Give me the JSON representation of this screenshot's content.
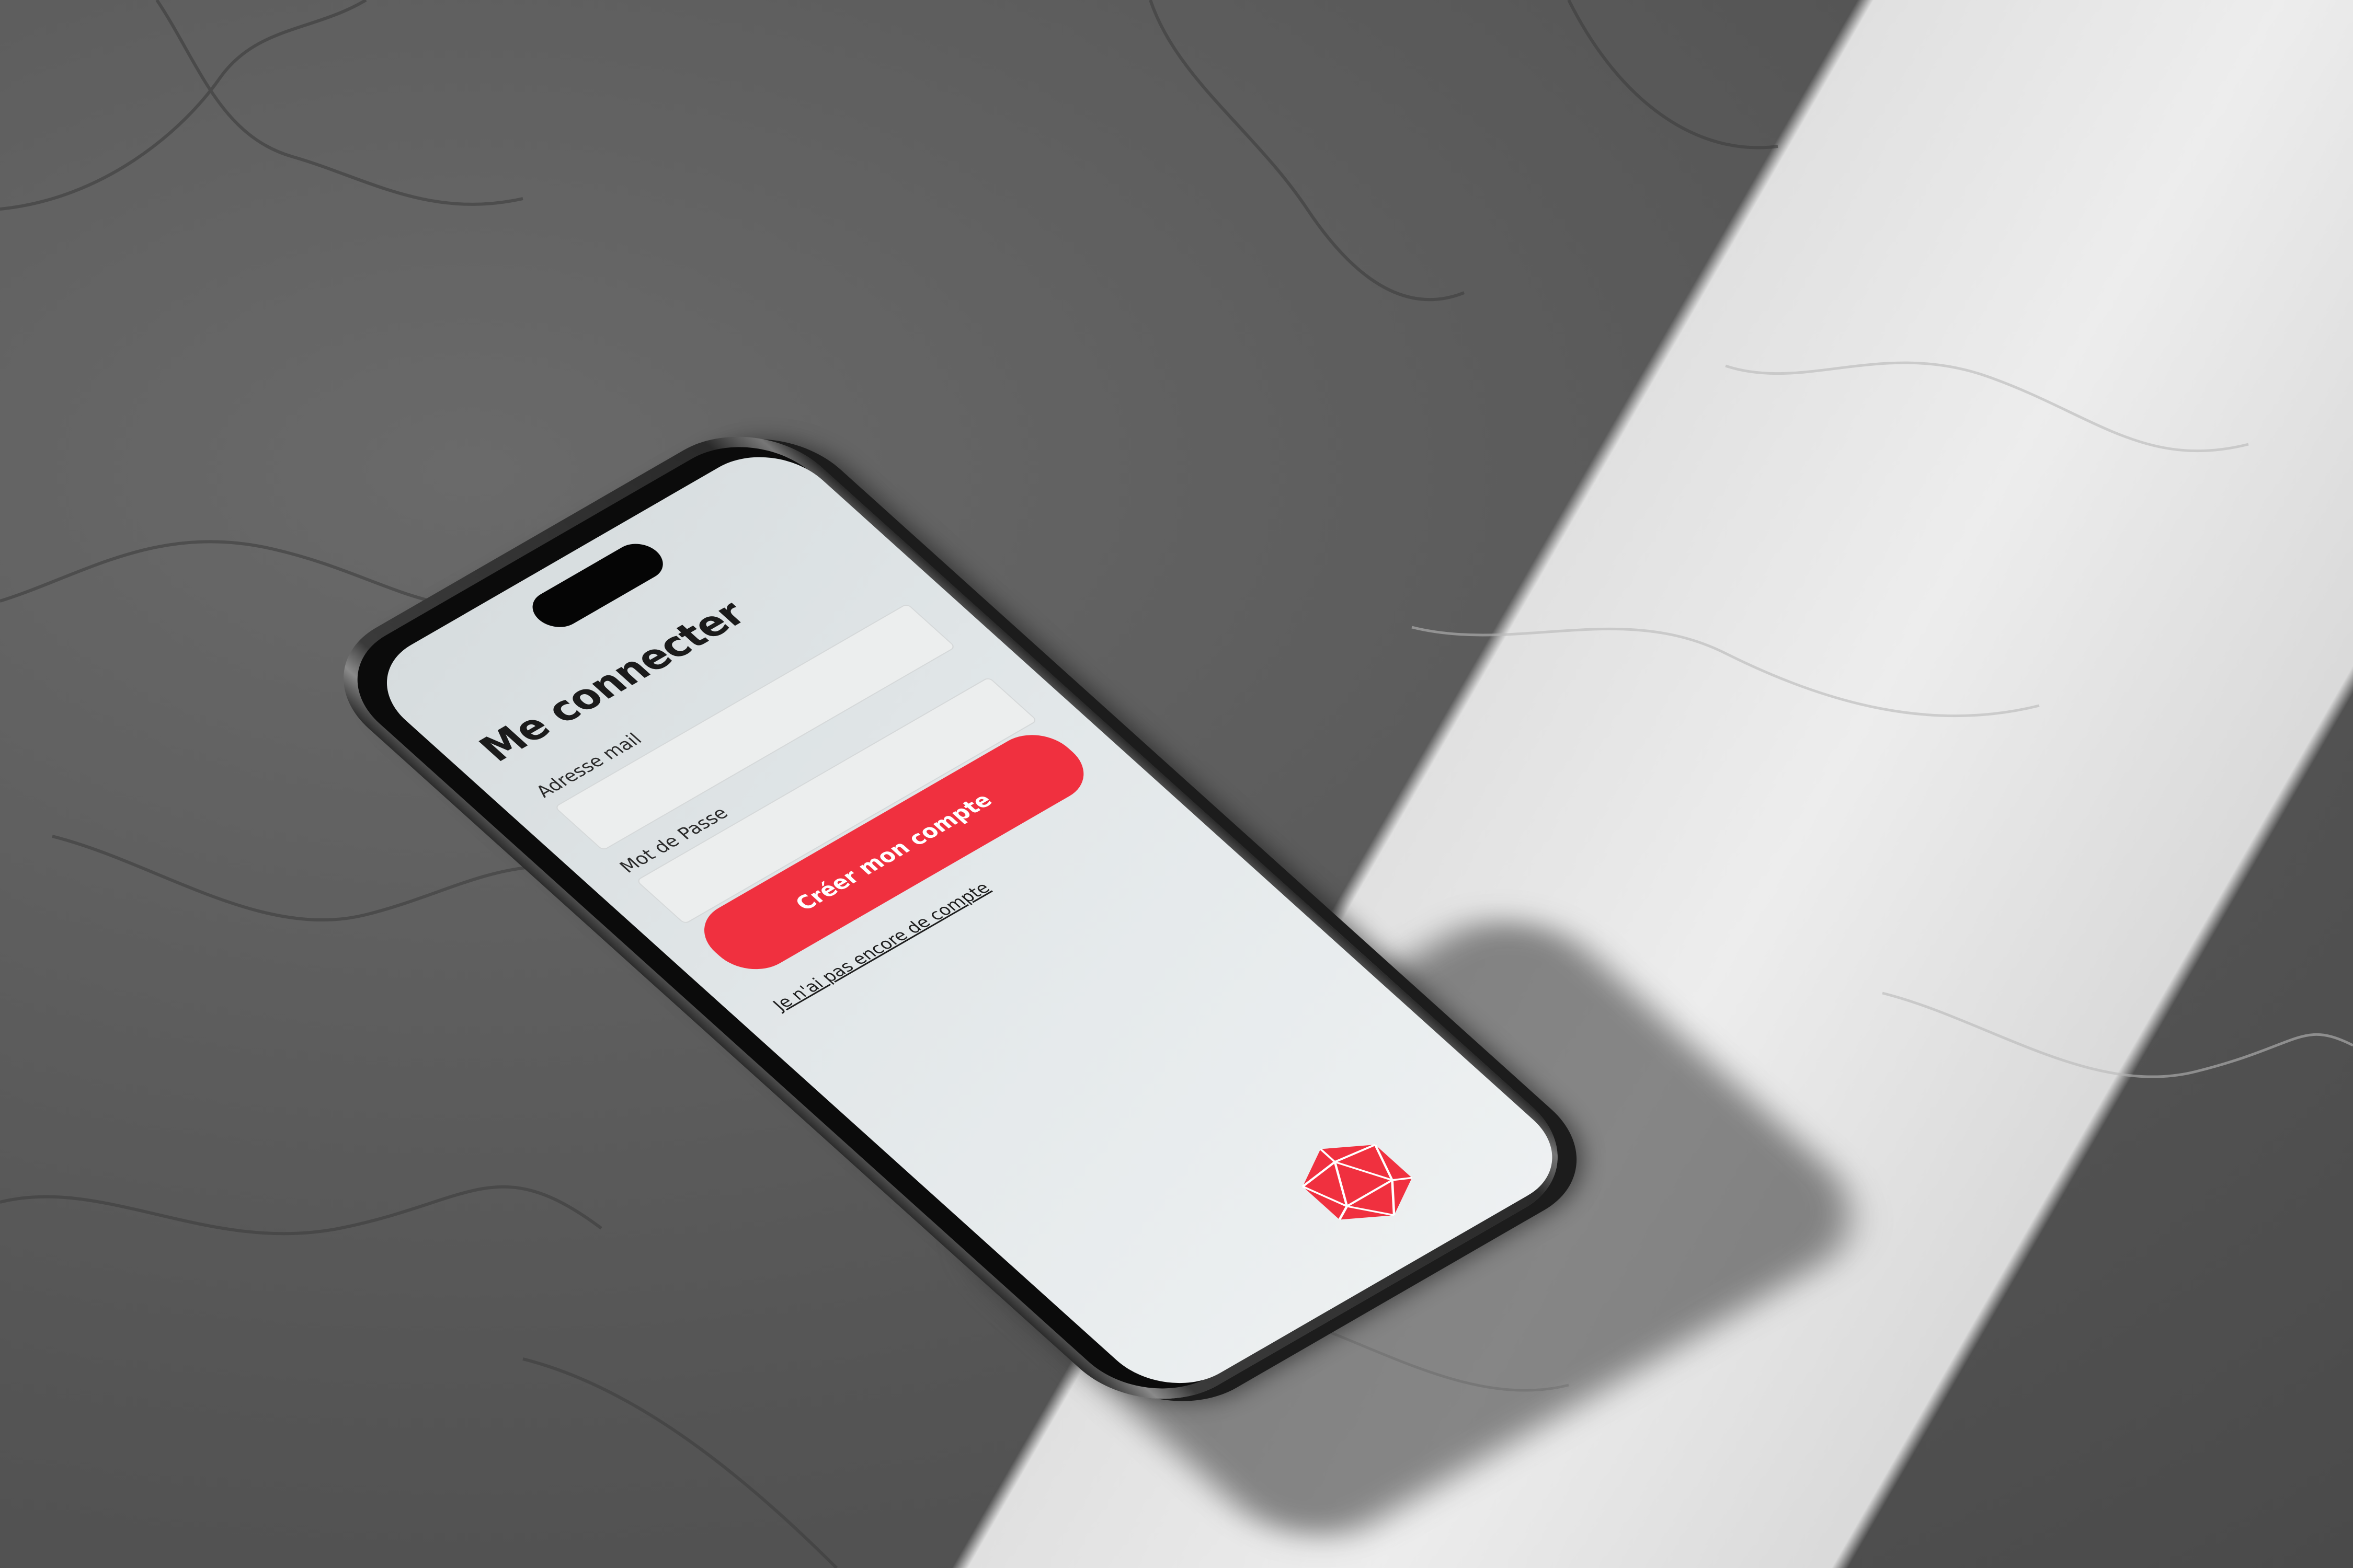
{
  "screen": {
    "title": "Me connecter",
    "email_label": "Adresse mail",
    "email_value": "",
    "password_label": "Mot de Passe",
    "password_value": "",
    "primary_button_label": "Créer mon compte",
    "secondary_link_label": "Je n'ai pas encore de compte"
  },
  "colors": {
    "accent": "#f0303f",
    "screen_background": "#e2e7e9",
    "input_background": "#eceeee",
    "text": "#1b1b1b"
  },
  "icons": {
    "logo": "d20-polyhedron-icon"
  }
}
